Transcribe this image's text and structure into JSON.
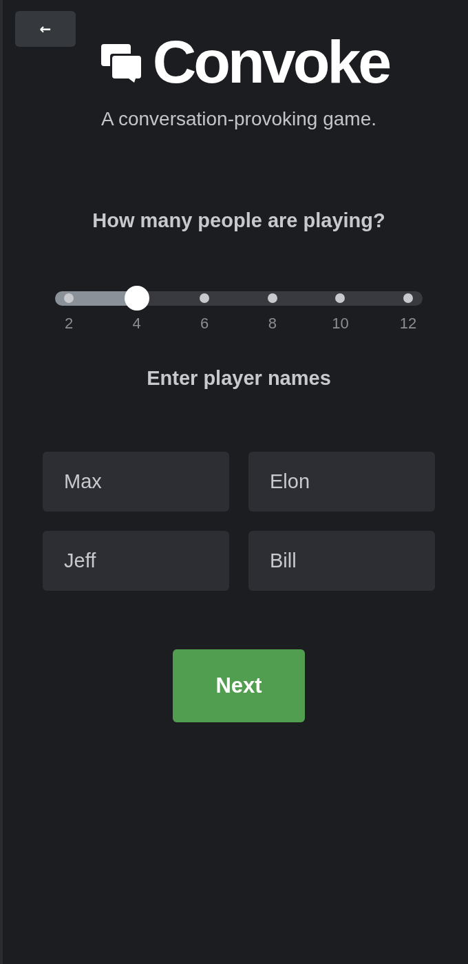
{
  "back_button": {
    "label": "←"
  },
  "logo": {
    "name": "Convoke"
  },
  "tagline": "A conversation-provoking game.",
  "player_count": {
    "question": "How many people are playing?",
    "slider": {
      "level": 0.2,
      "marks": [
        "2",
        "4",
        "6",
        "8",
        "10",
        "12"
      ]
    }
  },
  "player_names": {
    "heading": "Enter player names",
    "fields": [
      {
        "value": "Max"
      },
      {
        "value": "Elon"
      },
      {
        "value": "Jeff"
      },
      {
        "value": "Bill"
      }
    ]
  },
  "next_button": {
    "label": "Next"
  }
}
